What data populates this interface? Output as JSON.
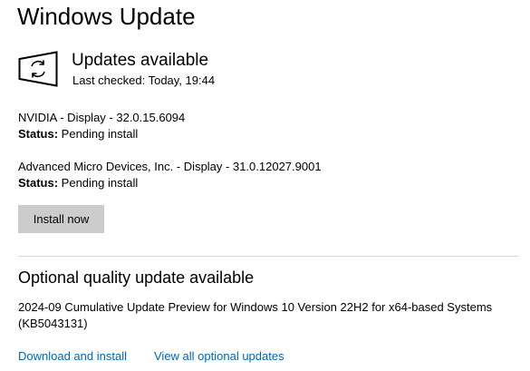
{
  "page": {
    "title": "Windows Update"
  },
  "status": {
    "icon": "sync-icon",
    "heading": "Updates available",
    "last_checked": "Last checked: Today, 19:44"
  },
  "updates": [
    {
      "name": "NVIDIA - Display - 32.0.15.6094",
      "status_label": "Status:",
      "status_value": " Pending install"
    },
    {
      "name": "Advanced Micro Devices, Inc. - Display - 31.0.12027.9001",
      "status_label": "Status:",
      "status_value": " Pending install"
    }
  ],
  "actions": {
    "install_label": "Install now"
  },
  "optional": {
    "heading": "Optional quality update available",
    "description_line1": "2024-09 Cumulative Update Preview for Windows 10 Version 22H2 for x64-based Systems",
    "description_line2": "(KB5043131)",
    "download_link": "Download and install",
    "view_all_link": "View all optional updates"
  },
  "colors": {
    "link": "#0067b8",
    "button_bg": "#cccccc",
    "divider": "#d9d9d9"
  }
}
